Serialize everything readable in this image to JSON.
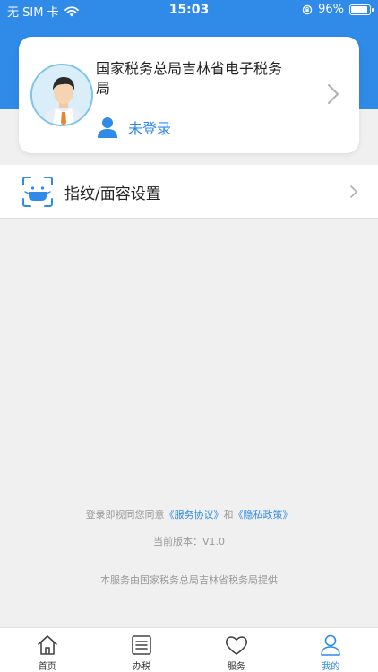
{
  "status_bar": {
    "carrier": "无 SIM 卡",
    "time": "15:03",
    "battery": "96%",
    "battery_level": 0.96
  },
  "profile": {
    "org_name": "国家税务总局吉林省电子税务局",
    "login_status": "未登录"
  },
  "settings": {
    "biometric_label": "指纹/面容设置"
  },
  "footer": {
    "agreement_prefix": "登录即视同您同意",
    "service_agreement": "《服务协议》",
    "conjunction": "和",
    "privacy_policy": "《隐私政策》",
    "version": "当前版本：V1.0",
    "provider": "本服务由国家税务总局吉林省税务局提供"
  },
  "tabs": [
    {
      "label": "首页",
      "icon": "home-icon",
      "active": false
    },
    {
      "label": "办税",
      "icon": "list-icon",
      "active": false
    },
    {
      "label": "服务",
      "icon": "heart-icon",
      "active": false
    },
    {
      "label": "我的",
      "icon": "person-icon",
      "active": true
    }
  ],
  "colors": {
    "accent": "#2f8ae8",
    "background": "#f0f0f0"
  }
}
